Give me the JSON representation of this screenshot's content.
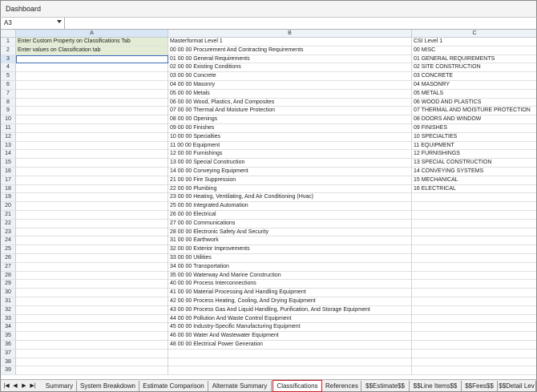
{
  "window": {
    "title": "Dashboard"
  },
  "formula_bar": {
    "cell_ref": "A3",
    "value": ""
  },
  "columns": [
    "A",
    "B",
    "C"
  ],
  "rows": [
    {
      "n": "1",
      "a": "Enter Custom Property on Classifications Tab",
      "b": "Masterformat Level 1",
      "c": "CSI Level 1"
    },
    {
      "n": "2",
      "a": "Enter values on Classification tab",
      "b": "00 00 00 Procurement And Contracting Requirements",
      "c": "00 MISC"
    },
    {
      "n": "3",
      "a": "",
      "b": "01 00 00 General Requirements",
      "c": "01 GENERAL REQUIREMENTS"
    },
    {
      "n": "4",
      "a": "",
      "b": "02 00 00 Existing Conditions",
      "c": "02 SITE CONSTRUCTION"
    },
    {
      "n": "5",
      "a": "",
      "b": "03 00 00 Concrete",
      "c": "03 CONCRETE"
    },
    {
      "n": "6",
      "a": "",
      "b": "04 00 00 Masonry",
      "c": "04 MASONRY"
    },
    {
      "n": "7",
      "a": "",
      "b": "05 00 00 Metals",
      "c": "05 METALS"
    },
    {
      "n": "8",
      "a": "",
      "b": "06 00 00 Wood, Plastics, And Composites",
      "c": "06 WOOD AND PLASTICS"
    },
    {
      "n": "9",
      "a": "",
      "b": "07 00 00 Thermal And Moisture Protection",
      "c": "07 THERMAL AND MOISTURE PROTECTION"
    },
    {
      "n": "10",
      "a": "",
      "b": "08 00 00 Openings",
      "c": "08 DOORS AND WINDOW"
    },
    {
      "n": "11",
      "a": "",
      "b": "09 00 00 Finishes",
      "c": "09 FINISHES"
    },
    {
      "n": "12",
      "a": "",
      "b": "10 00 00 Specialties",
      "c": "10 SPECIALTIES"
    },
    {
      "n": "13",
      "a": "",
      "b": "11 00 00 Equipment",
      "c": "11 EQUIPMENT"
    },
    {
      "n": "14",
      "a": "",
      "b": "12 00 00 Furnishings",
      "c": "12 FURNISHINGS"
    },
    {
      "n": "15",
      "a": "",
      "b": "13 00 00 Special Construction",
      "c": "13 SPECIAL CONSTRUCTION"
    },
    {
      "n": "16",
      "a": "",
      "b": "14 00 00 Conveying Equipment",
      "c": "14 CONVEYING SYSTEMS"
    },
    {
      "n": "17",
      "a": "",
      "b": "21 00 00 Fire Suppression",
      "c": "15 MECHANICAL"
    },
    {
      "n": "18",
      "a": "",
      "b": "22 00 00 Plumbing",
      "c": "16 ELECTRICAL"
    },
    {
      "n": "19",
      "a": "",
      "b": "23 00 00 Heating, Ventilating, And Air Conditioning (Hvac)",
      "c": ""
    },
    {
      "n": "20",
      "a": "",
      "b": "25 00 00 Integrated Automation",
      "c": ""
    },
    {
      "n": "21",
      "a": "",
      "b": "26 00 00 Electrical",
      "c": ""
    },
    {
      "n": "22",
      "a": "",
      "b": "27 00 00 Communications",
      "c": ""
    },
    {
      "n": "23",
      "a": "",
      "b": "28 00 00 Electronic Safety And Security",
      "c": ""
    },
    {
      "n": "24",
      "a": "",
      "b": "31 00 00 Earthwork",
      "c": ""
    },
    {
      "n": "25",
      "a": "",
      "b": "32 00 00 Exterior Improvements",
      "c": ""
    },
    {
      "n": "26",
      "a": "",
      "b": "33 00 00 Utilities",
      "c": ""
    },
    {
      "n": "27",
      "a": "",
      "b": "34 00 00 Transportation",
      "c": ""
    },
    {
      "n": "28",
      "a": "",
      "b": "35 00 00 Waterway And Marine Construction",
      "c": ""
    },
    {
      "n": "29",
      "a": "",
      "b": "40 00 00 Process Interconnections",
      "c": ""
    },
    {
      "n": "30",
      "a": "",
      "b": "41 00 00 Material Processing And Handling Equipment",
      "c": ""
    },
    {
      "n": "31",
      "a": "",
      "b": "42 00 00 Process Heating, Cooling, And Drying Equipment",
      "c": ""
    },
    {
      "n": "32",
      "a": "",
      "b": "43 00 00 Process Gas And Liquid Handling, Purification, And Storage Equipment",
      "c": ""
    },
    {
      "n": "33",
      "a": "",
      "b": "44 00 00 Pollution And Waste Control Equipment",
      "c": ""
    },
    {
      "n": "34",
      "a": "",
      "b": "45 00 00 Industry-Specific Manufacturing Equipment",
      "c": ""
    },
    {
      "n": "35",
      "a": "",
      "b": "46 00 00 Water And Wastewater Equipment",
      "c": ""
    },
    {
      "n": "36",
      "a": "",
      "b": "48 00 00 Electrical Power Generation",
      "c": ""
    },
    {
      "n": "37",
      "a": "",
      "b": "",
      "c": ""
    },
    {
      "n": "38",
      "a": "",
      "b": "",
      "c": ""
    },
    {
      "n": "39",
      "a": "",
      "b": "",
      "c": ""
    }
  ],
  "tabs": [
    {
      "label": "Summary"
    },
    {
      "label": "System Breakdown"
    },
    {
      "label": "Estimate Comparison"
    },
    {
      "label": "Alternate Summary"
    },
    {
      "label": "Classifications",
      "active": true
    },
    {
      "label": "References"
    },
    {
      "label": "$$Estimate$$"
    },
    {
      "label": "$$Line Items$$"
    },
    {
      "label": "$$Fees$$"
    },
    {
      "label": "$$Detail Lev"
    }
  ],
  "nav_icons": [
    "first-sheet-icon",
    "prev-sheet-icon",
    "next-sheet-icon",
    "last-sheet-icon"
  ],
  "colors": {
    "green_cell": "#e3edd5",
    "active_tab_border": "#d0202a",
    "selection": "#3a6db5"
  }
}
